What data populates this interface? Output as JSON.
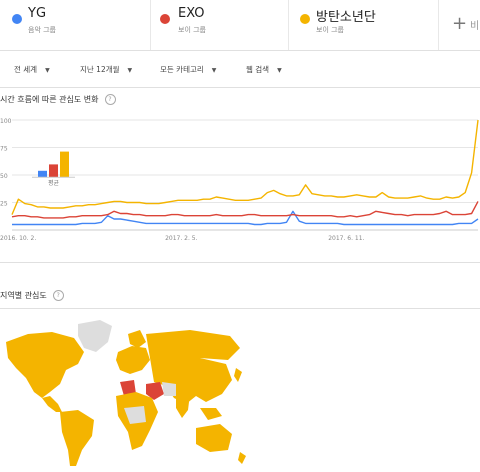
{
  "search_terms": [
    {
      "title": "YG",
      "subtitle": "음악 그룹",
      "color": "#4285f4"
    },
    {
      "title": "EXO",
      "subtitle": "보이 그룹",
      "color": "#db4437"
    },
    {
      "title": "방탄소년단",
      "subtitle": "보이 그룹",
      "color": "#f4b400"
    }
  ],
  "add_term": {
    "icon": "+",
    "label": "비"
  },
  "filters": {
    "region": "전 세계",
    "period": "지난 12개월",
    "category": "모든 카테고리",
    "search_type": "웹 검색"
  },
  "interest_over_time": {
    "title": "시간 흐름에 따른 관심도 변화",
    "help": "?"
  },
  "interest_by_region": {
    "title": "지역별 관심도",
    "help": "?"
  },
  "chart_data": {
    "type": "line",
    "title": "시간 흐름에 따른 관심도 변화",
    "y_ticks": [
      "100",
      "75",
      "50",
      "25"
    ],
    "ylim": [
      0,
      100
    ],
    "x_ticks": [
      "2016. 10. 2.",
      "2017. 2. 5.",
      "2017. 6. 11."
    ],
    "grid": true,
    "average": {
      "label": "평균",
      "values": [
        4,
        8,
        16
      ]
    },
    "series": [
      {
        "name": "YG",
        "color": "#4285f4",
        "values": [
          5,
          5,
          5,
          5,
          5,
          5,
          5,
          5,
          5,
          5,
          5,
          6,
          6,
          6,
          7,
          13,
          10,
          10,
          9,
          8,
          7,
          6,
          6,
          6,
          6,
          6,
          6,
          6,
          6,
          6,
          6,
          6,
          6,
          6,
          6,
          6,
          6,
          6,
          5,
          5,
          6,
          6,
          6,
          7,
          17,
          8,
          6,
          6,
          6,
          6,
          6,
          6,
          5,
          5,
          5,
          5,
          5,
          5,
          5,
          5,
          5,
          5,
          5,
          5,
          5,
          5,
          5,
          5,
          5,
          5,
          6,
          6,
          6,
          10
        ]
      },
      {
        "name": "EXO",
        "color": "#db4437",
        "values": [
          12,
          13,
          13,
          12,
          12,
          11,
          11,
          11,
          11,
          12,
          12,
          13,
          13,
          13,
          13,
          14,
          17,
          15,
          15,
          14,
          14,
          13,
          13,
          13,
          13,
          14,
          14,
          13,
          13,
          13,
          13,
          13,
          14,
          13,
          13,
          13,
          13,
          14,
          14,
          13,
          13,
          13,
          13,
          13,
          14,
          13,
          13,
          13,
          13,
          13,
          13,
          12,
          12,
          13,
          12,
          13,
          14,
          17,
          16,
          15,
          14,
          14,
          13,
          14,
          14,
          14,
          14,
          15,
          17,
          14,
          14,
          14,
          15,
          26
        ]
      },
      {
        "name": "방탄소년단",
        "color": "#f4b400",
        "values": [
          14,
          28,
          24,
          23,
          21,
          21,
          20,
          20,
          20,
          21,
          22,
          22,
          23,
          23,
          24,
          25,
          26,
          26,
          25,
          25,
          25,
          24,
          24,
          24,
          25,
          26,
          27,
          27,
          27,
          27,
          28,
          28,
          30,
          29,
          28,
          27,
          27,
          27,
          28,
          29,
          34,
          36,
          33,
          31,
          31,
          32,
          41,
          33,
          32,
          31,
          31,
          30,
          30,
          31,
          32,
          31,
          30,
          30,
          34,
          30,
          29,
          29,
          29,
          30,
          31,
          29,
          28,
          28,
          30,
          29,
          30,
          34,
          52,
          100
        ]
      }
    ]
  },
  "map_colors": {
    "ocean": "#ffffff",
    "land_default": "#dddddd",
    "yg": "#4285f4",
    "exo": "#db4437",
    "bts": "#f4b400"
  }
}
